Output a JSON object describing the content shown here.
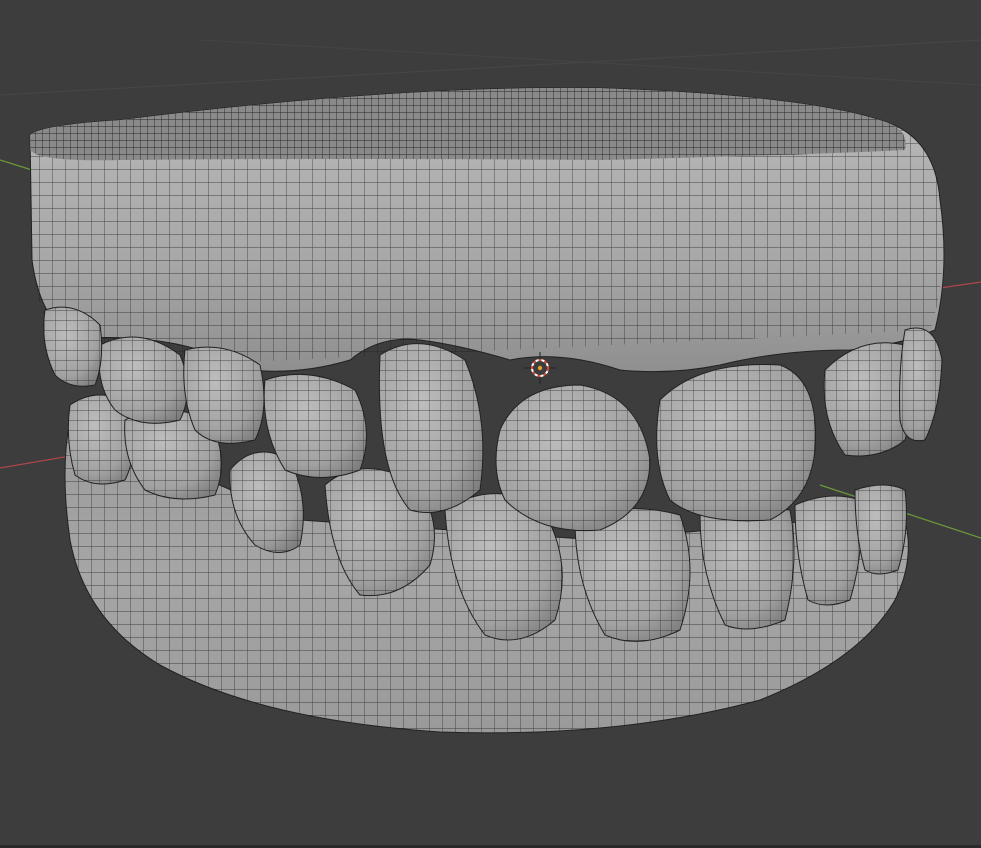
{
  "viewport": {
    "background_color": "#3d3d3d",
    "grid_line_color": "#474747",
    "axis_x_color": "#b0454c",
    "axis_y_color": "#6a9a3a",
    "mesh_fill_color": "#a9a9a9",
    "mesh_wire_color": "#1a1a1a",
    "object": "dental-mesh",
    "view_mode": "wireframe-overlay",
    "cursor": "3d-cursor-icon"
  }
}
